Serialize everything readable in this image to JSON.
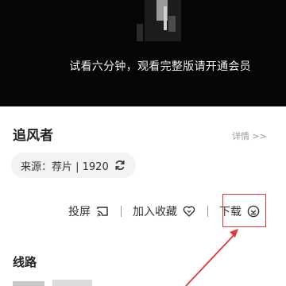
{
  "player": {
    "trial_notice": "试看六分钟，观看完整版请开通会员"
  },
  "movie": {
    "title": "追风者",
    "details_link": "详情 >>",
    "source_label": "来源：荐片 | 1920",
    "refresh_icon": "refresh-icon"
  },
  "actions": {
    "cast_label": "投屏",
    "cast_icon": "cast-icon",
    "favorite_label": "加入收藏",
    "favorite_icon": "heart-icon",
    "download_label": "下载",
    "download_icon": "download-circle-icon"
  },
  "lines": {
    "section_title": "线路"
  },
  "annotation": {
    "color": "#e23a3a"
  }
}
